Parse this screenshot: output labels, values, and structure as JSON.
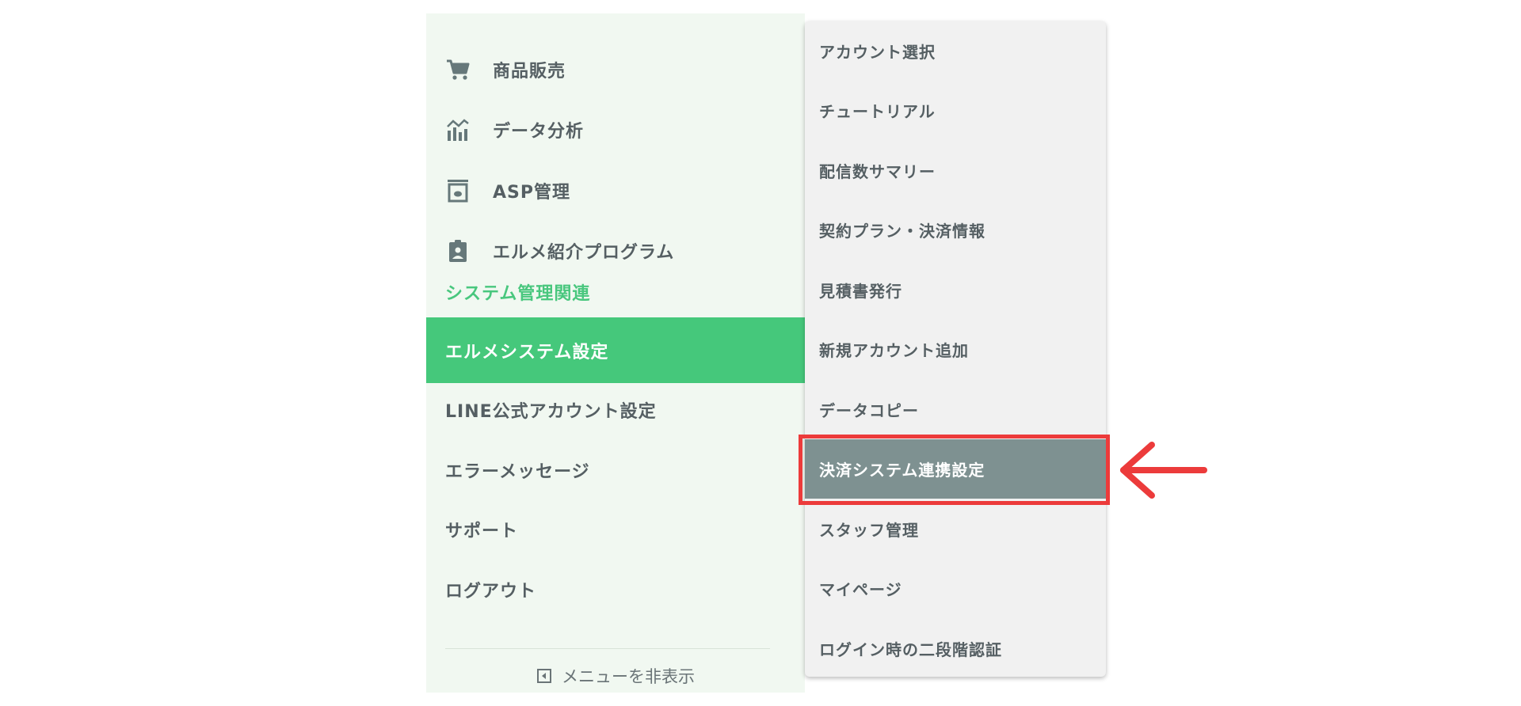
{
  "sidebar": {
    "icon_items": [
      {
        "label": "商品販売",
        "icon": "cart-icon"
      },
      {
        "label": "データ分析",
        "icon": "analytics-icon"
      },
      {
        "label": "ASP管理",
        "icon": "archive-box-icon"
      },
      {
        "label": "エルメ紹介プログラム",
        "icon": "badge-icon"
      }
    ],
    "section_title": "システム管理関連",
    "items": [
      {
        "label": "エルメシステム設定",
        "active": true
      },
      {
        "label": "LINE公式アカウント設定"
      },
      {
        "label": "エラーメッセージ"
      },
      {
        "label": "サポート"
      },
      {
        "label": "ログアウト"
      }
    ],
    "hide_menu": {
      "label": "メニューを非表示",
      "icon": "collapse-left-icon"
    }
  },
  "submenu": {
    "items": [
      {
        "label": "アカウント選択"
      },
      {
        "label": "チュートリアル"
      },
      {
        "label": "配信数サマリー"
      },
      {
        "label": "契約プラン・決済情報"
      },
      {
        "label": "見積書発行"
      },
      {
        "label": "新規アカウント追加"
      },
      {
        "label": "データコピー"
      },
      {
        "label": "決済システム連携設定",
        "selected": true
      },
      {
        "label": "スタッフ管理"
      },
      {
        "label": "マイページ"
      },
      {
        "label": "ログイン時の二段階認証"
      }
    ]
  },
  "colors": {
    "sidebar_bg": "#f1f8f1",
    "accent_green": "#45c87b",
    "submenu_bg": "#f1f1f1",
    "submenu_selected": "#7e9191",
    "annotation_red": "#ec3b3b"
  }
}
